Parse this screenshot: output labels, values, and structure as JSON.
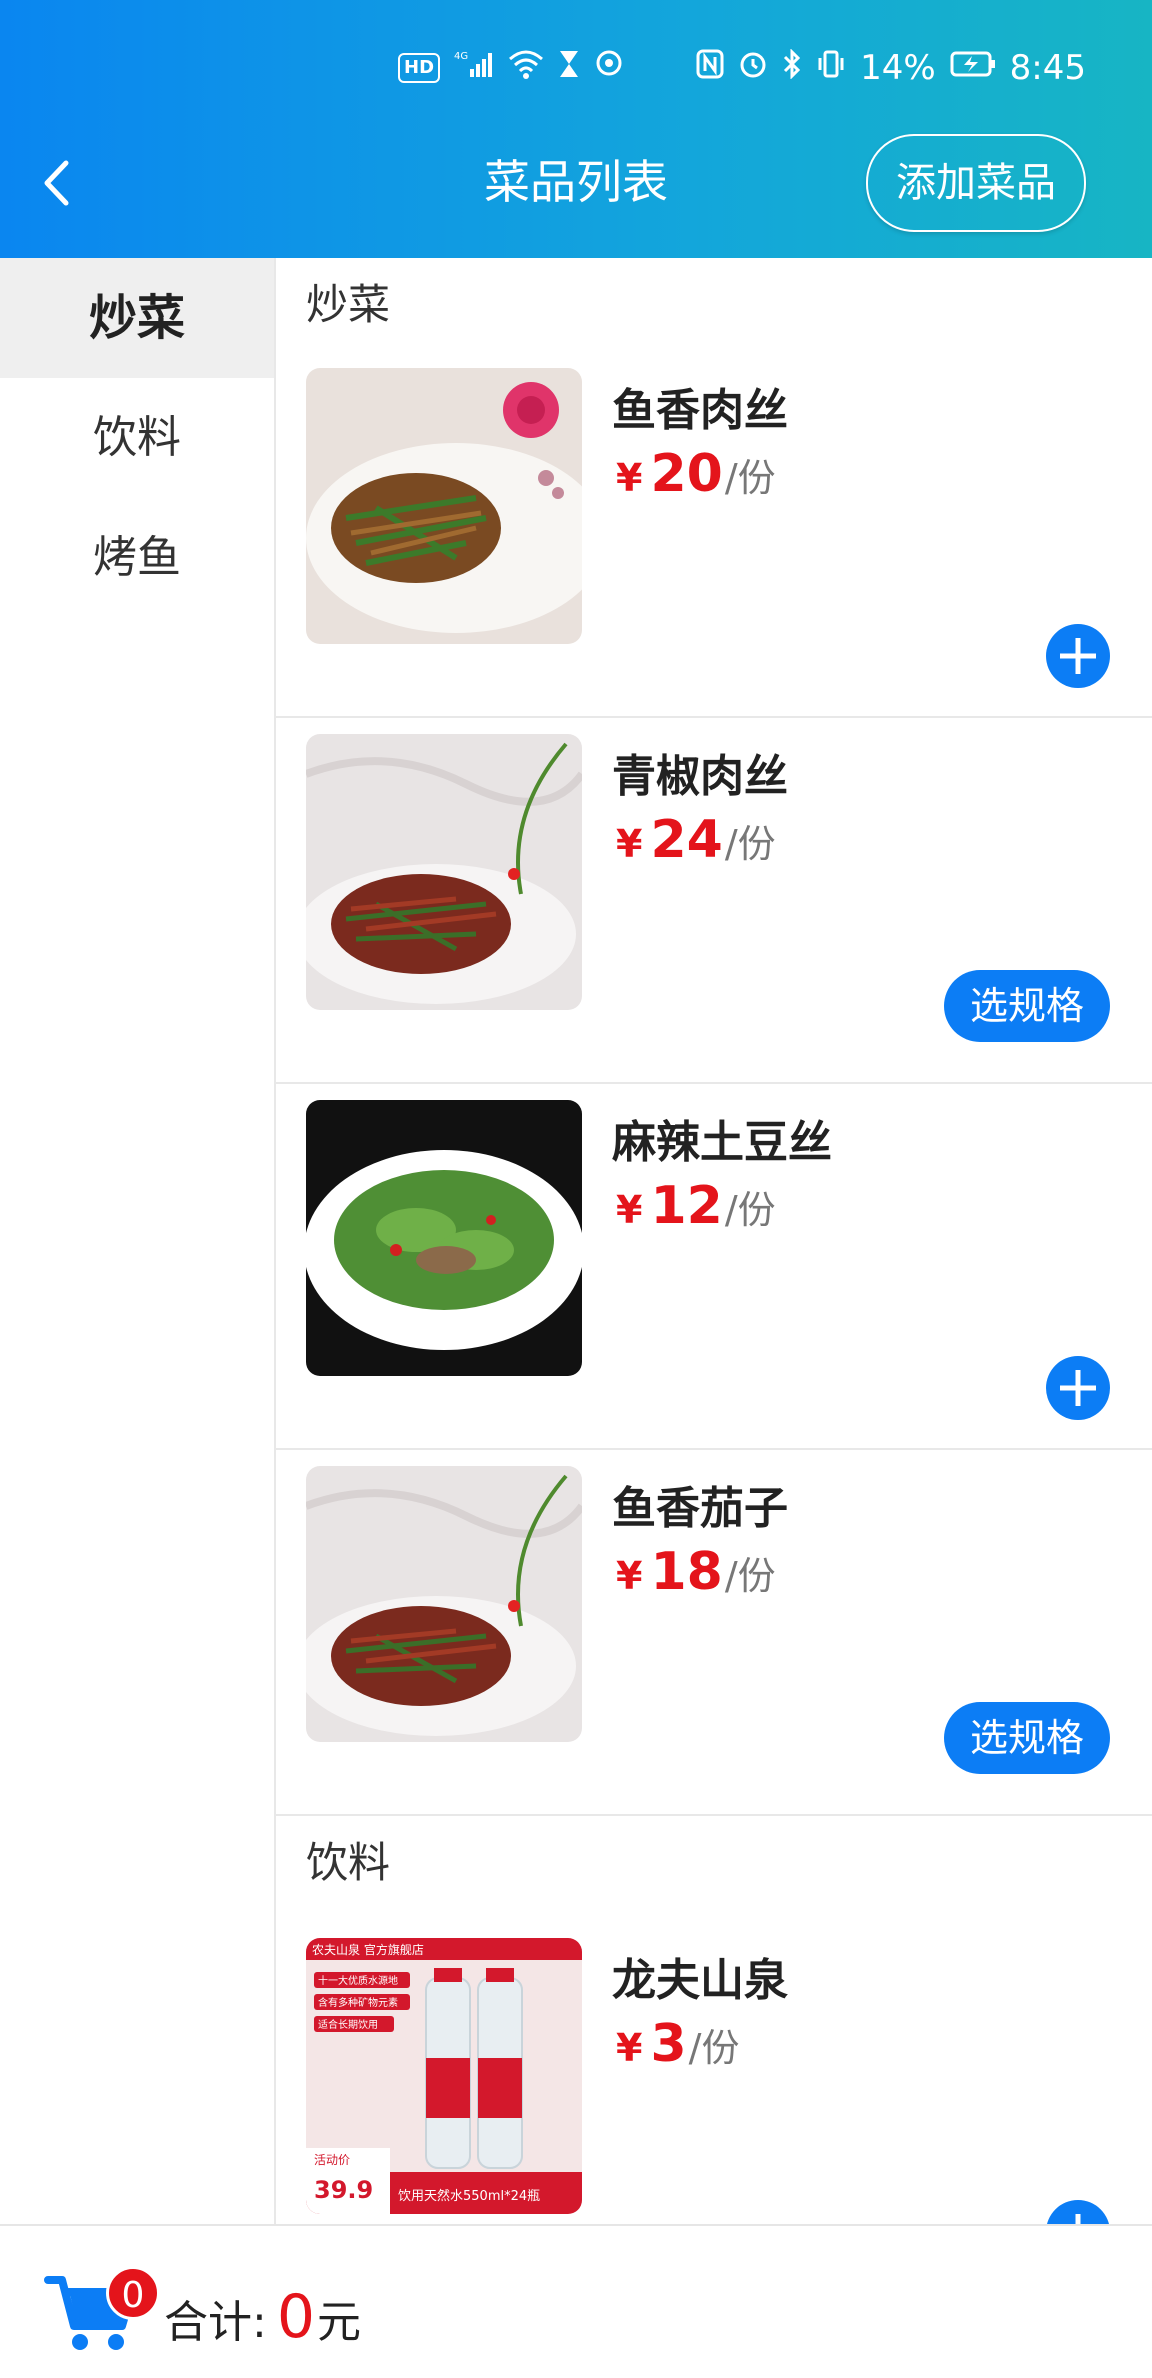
{
  "status_bar": {
    "battery": "14%",
    "time": "8:45",
    "left_icons": [
      "hd-icon",
      "signal-icon",
      "wifi-icon",
      "hourglass-icon",
      "hotspot-icon"
    ],
    "right_icons": [
      "nfc-icon",
      "alarm-icon",
      "bluetooth-icon",
      "vibrate-icon",
      "battery-icon"
    ]
  },
  "header": {
    "title": "菜品列表",
    "add_button": "添加菜品",
    "back_icon": "chevron-left-icon"
  },
  "sidebar": {
    "items": [
      {
        "label": "炒菜",
        "active": true
      },
      {
        "label": "饮料",
        "active": false
      },
      {
        "label": "烤鱼",
        "active": false
      }
    ]
  },
  "sections": [
    {
      "title": "炒菜",
      "dishes": [
        {
          "name": "鱼香肉丝",
          "currency": "¥",
          "price": "20",
          "unit": "/份",
          "action": "add"
        },
        {
          "name": "青椒肉丝",
          "currency": "¥",
          "price": "24",
          "unit": "/份",
          "action": "spec",
          "action_label": "选规格"
        },
        {
          "name": "麻辣土豆丝",
          "currency": "¥",
          "price": "12",
          "unit": "/份",
          "action": "add"
        },
        {
          "name": "鱼香茄子",
          "currency": "¥",
          "price": "18",
          "unit": "/份",
          "action": "spec",
          "action_label": "选规格"
        }
      ]
    },
    {
      "title": "饮料",
      "dishes": [
        {
          "name": "龙夫山泉",
          "currency": "¥",
          "price": "3",
          "unit": "/份",
          "action": "add"
        }
      ]
    }
  ],
  "water_image": {
    "store_banner": "农夫山泉 官方旗舰店",
    "tags": [
      "十一大优质水源地",
      "含有多种矿物元素",
      "适合长期饮用"
    ],
    "promo_label": "活动价",
    "promo_price": "39.9",
    "bottom_text": "饮用天然水550ml*24瓶"
  },
  "footer": {
    "cart_count": "0",
    "total_label": "合计:",
    "total_amount": "0",
    "total_unit": "元"
  },
  "colors": {
    "primary": "#0c7df5",
    "price_red": "#e4141b",
    "header_gradient_start": "#0a86f0",
    "header_gradient_end": "#17b5c4"
  }
}
